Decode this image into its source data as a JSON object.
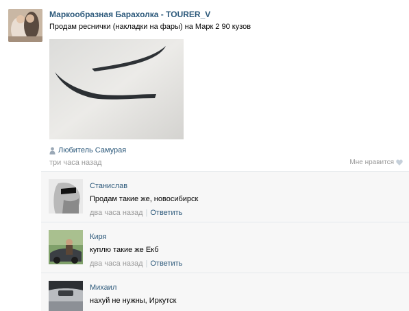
{
  "post": {
    "group_name": "Маркообразная Барахолка - TOURER_V",
    "text": "Продам реснички (накладки на фары) на Марк 2 90 кузов",
    "signer": "Любитель Самурая",
    "time": "три часа назад",
    "like_label": "Мне нравится"
  },
  "replies": [
    {
      "author": "Станислав",
      "text": "Продам такие же, новосибирск",
      "time": "два часа назад",
      "action": "Ответить"
    },
    {
      "author": "Киря",
      "text": "куплю такие же Екб",
      "time": "два часа назад",
      "action": "Ответить"
    },
    {
      "author": "Михаил",
      "text": "нахуй не нужны, Иркутск",
      "time": "",
      "action": ""
    }
  ],
  "colors": {
    "link": "#2b587a",
    "meta": "#999999",
    "reply_bg": "#f7f7f7"
  },
  "icons": {
    "signer": "person-icon",
    "like": "heart-icon"
  }
}
